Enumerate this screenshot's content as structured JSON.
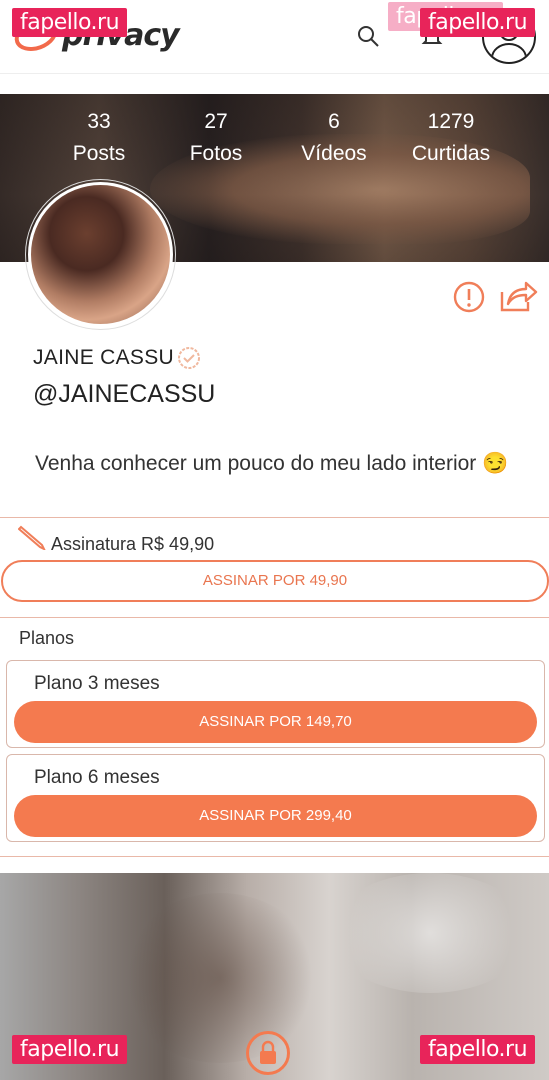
{
  "header": {
    "logo_text": "privacy",
    "watermark": "fapello.ru",
    "brand_color": "#f47a4f"
  },
  "profile": {
    "stats": [
      {
        "value": "33",
        "label": "Posts"
      },
      {
        "value": "27",
        "label": "Fotos"
      },
      {
        "value": "6",
        "label": "Vídeos"
      },
      {
        "value": "1279",
        "label": "Curtidas"
      }
    ],
    "name": "JAINE CASSU",
    "handle": "@JAINECASSU",
    "bio": "Venha conhecer um pouco do meu lado interior 😏"
  },
  "subscription": {
    "label": "Assinatura R$ 49,90",
    "button": "ASSINAR POR 49,90"
  },
  "plans": {
    "title": "Planos",
    "items": [
      {
        "name": "Plano 3 meses",
        "button": "ASSINAR POR 149,70"
      },
      {
        "name": "Plano 6 meses",
        "button": "ASSINAR POR 299,40"
      }
    ]
  },
  "icons": {
    "search": "search-icon",
    "bell": "bell-icon",
    "report": "report-icon",
    "share": "share-icon",
    "verified": "verified-icon",
    "pencil": "pencil-icon",
    "lock": "lock-icon"
  }
}
